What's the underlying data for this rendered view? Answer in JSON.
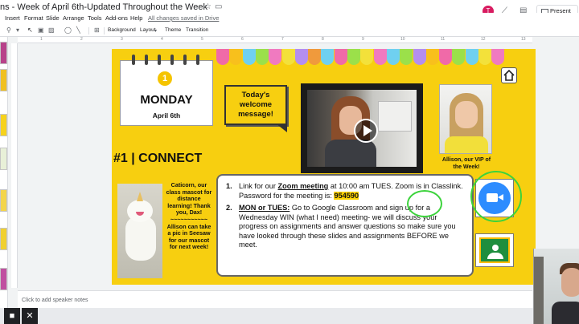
{
  "doc": {
    "title": "ns - Week of April 6th-Updated Throughout the Week",
    "menu": [
      "Insert",
      "Format",
      "Slide",
      "Arrange",
      "Tools",
      "Add-ons",
      "Help"
    ],
    "saved_status": "All changes saved in Drive",
    "avatar_letter": "T",
    "present_label": "Present"
  },
  "toolbar": {
    "background_label": "Background",
    "layout_label": "Layout",
    "theme_label": "Theme",
    "transition_label": "Transition"
  },
  "ruler": [
    "1",
    "2",
    "3",
    "4",
    "5",
    "6",
    "7",
    "8",
    "9",
    "10",
    "11",
    "12",
    "13"
  ],
  "slide": {
    "calendar": {
      "number": "1",
      "day": "MONDAY",
      "date": "April 6th"
    },
    "connect_title": "#1 | CONNECT",
    "bubble_text": "Today's welcome message!",
    "vip_caption": "Allison, our VIP of the Week!",
    "mascot_text": "Caticorn, our class mascot for distance learning! Thank you, Dax! ~~~~~~~~~~~ Allison can take a pic in Seesaw for our mascot for next week!",
    "item1": {
      "num": "1.",
      "pre": "Link for our ",
      "link": "Zoom meeting",
      "post": " at 10:00 am TUES. Zoom is in Classlink. Password for the meeting is: ",
      "password": "954590"
    },
    "item2": {
      "num": "2.",
      "bold": "MON or TUES:",
      "text": " Go to Google Classroom and sign up for a Wednesday WIN (what I need) meeting- we will discuss your progress on assignments and answer questions so make sure you have looked through these slides and assignments BEFORE we meet."
    },
    "flag_colors": [
      "#f06aa8",
      "#f8c01c",
      "#6fd0f0",
      "#9be04a",
      "#f07ac0",
      "#f3e13a",
      "#b48ef0",
      "#f09a3c",
      "#6fd0f0",
      "#f06aa8",
      "#9be04a",
      "#f3e13a",
      "#f07ac0",
      "#6fd0f0",
      "#9be04a",
      "#b48ef0",
      "#f8c01c",
      "#f06aa8",
      "#9be04a",
      "#6fd0f0",
      "#f3e13a",
      "#f07ac0"
    ]
  },
  "notes": {
    "placeholder": "Click to add speaker notes"
  },
  "icons": [
    "undo-icon",
    "zoom-icon",
    "cursor-icon",
    "text-box-icon",
    "image-icon",
    "shape-icon",
    "line-icon",
    "comment-icon",
    "home-icon",
    "zoom-app-icon",
    "google-classroom-icon",
    "play-icon",
    "video-camera-icon",
    "close-icon"
  ]
}
